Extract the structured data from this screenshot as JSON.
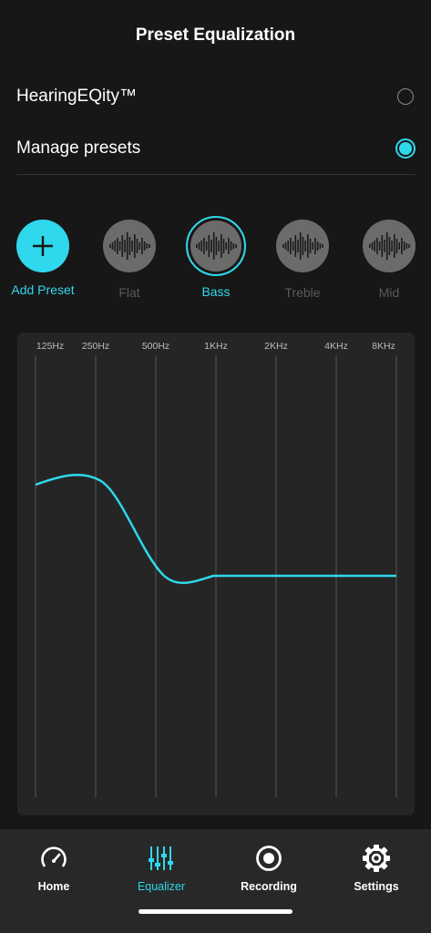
{
  "header": {
    "title": "Preset Equalization"
  },
  "options": [
    {
      "label": "HearingEQity™",
      "selected": false
    },
    {
      "label": "Manage presets",
      "selected": true
    }
  ],
  "presets": {
    "add_label": "Add Preset",
    "items": [
      {
        "label": "Flat",
        "active": false
      },
      {
        "label": "Bass",
        "active": true
      },
      {
        "label": "Treble",
        "active": false
      },
      {
        "label": "Mid",
        "active": false
      }
    ]
  },
  "equalizer": {
    "frequency_labels": [
      "125Hz",
      "250Hz",
      "500Hz",
      "1KHz",
      "2KHz",
      "4KHz",
      "8KHz"
    ],
    "curve_color": "#2fd8ec"
  },
  "tabbar": {
    "tabs": [
      {
        "label": "Home",
        "icon": "speedometer-icon",
        "active": false
      },
      {
        "label": "Equalizer",
        "icon": "equalizer-sliders-icon",
        "active": true
      },
      {
        "label": "Recording",
        "icon": "record-icon",
        "active": false
      },
      {
        "label": "Settings",
        "icon": "gear-icon",
        "active": false
      }
    ]
  },
  "colors": {
    "accent": "#2fd8ec",
    "background": "#171717",
    "panel": "#252525",
    "tabbar": "#282828"
  }
}
